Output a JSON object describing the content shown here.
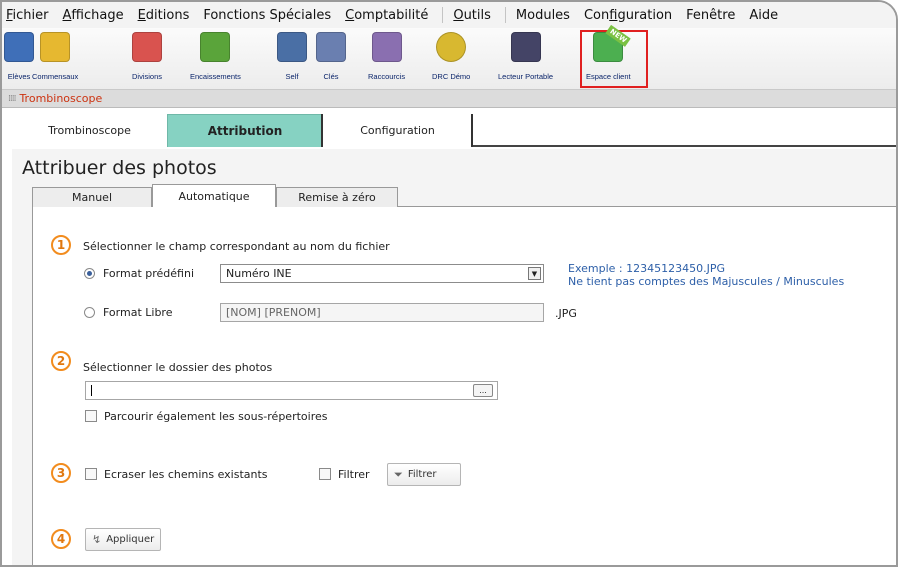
{
  "menu": [
    {
      "pre": "",
      "u": "F",
      "post": "ichier"
    },
    {
      "pre": "",
      "u": "A",
      "post": "ffichage"
    },
    {
      "pre": "",
      "u": "E",
      "post": "ditions"
    },
    {
      "pre": "Fonctions Spéciales",
      "u": "",
      "post": ""
    },
    {
      "pre": "",
      "u": "C",
      "post": "omptabilité"
    },
    {
      "pre": "",
      "u": "O",
      "post": "utils"
    },
    {
      "pre": "Modules",
      "u": "",
      "post": ""
    },
    {
      "pre": "Con",
      "u": "f",
      "post": "iguration"
    },
    {
      "pre": "Fenêtre",
      "u": "",
      "post": ""
    },
    {
      "pre": "Aide",
      "u": "",
      "post": ""
    }
  ],
  "toolbar": [
    {
      "label": "Elèves",
      "icon": "students-icon",
      "color": "#3f6fb8"
    },
    {
      "label": "Commensaux",
      "icon": "dining-icon",
      "color": "#e6b830"
    },
    {
      "label": "Divisions",
      "icon": "divisions-icon",
      "color": "#d9534f"
    },
    {
      "label": "Encaissements",
      "icon": "payments-icon",
      "color": "#5aa43a"
    },
    {
      "label": "Self",
      "icon": "self-icon",
      "color": "#4a6fa5"
    },
    {
      "label": "Clés",
      "icon": "keys-icon",
      "color": "#6a7fb0"
    },
    {
      "label": "Raccourcis",
      "icon": "shortcuts-icon",
      "color": "#8a6fb0"
    },
    {
      "label": "DRC Démo",
      "icon": "euro-icon",
      "color": "#d8b830"
    },
    {
      "label": "Lecteur Portable",
      "icon": "reader-icon",
      "color": "#444466"
    },
    {
      "label": "Espace client",
      "icon": "client-area-icon",
      "color": "#4caf50",
      "badge": "NEW"
    }
  ],
  "strip_title": "Trombinoscope",
  "main_tabs": [
    "Trombinoscope",
    "Attribution",
    "Configuration"
  ],
  "page_title": "Attribuer des photos",
  "sub_tabs": [
    "Manuel",
    "Automatique",
    "Remise à zéro"
  ],
  "steps": [
    "1",
    "2",
    "3",
    "4"
  ],
  "section1": {
    "title": "Sélectionner le champ correspondant au nom du fichier",
    "radio1_label": "Format prédéfini",
    "select_value": "Numéro INE",
    "example": "Exemple : 12345123450.JPG",
    "note": "Ne tient pas comptes des Majuscules / Minuscules",
    "radio2_label": "Format Libre",
    "free_placeholder": "[NOM] [PRENOM]",
    "ext": ".JPG"
  },
  "section2": {
    "title": "Sélectionner le dossier des photos",
    "folder_value": "",
    "browse": "...",
    "subdirs": "Parcourir également les sous-répertoires"
  },
  "section3": {
    "overwrite": "Ecraser les chemins existants",
    "filter_check": "Filtrer",
    "filter_button": "Filtrer"
  },
  "section4": {
    "apply": "Appliquer"
  },
  "colors": {
    "active_tab": "#86d2c2",
    "step_orange": "#f28c1e",
    "link_blue": "#2d5fa8",
    "title_red": "#cc3311"
  }
}
